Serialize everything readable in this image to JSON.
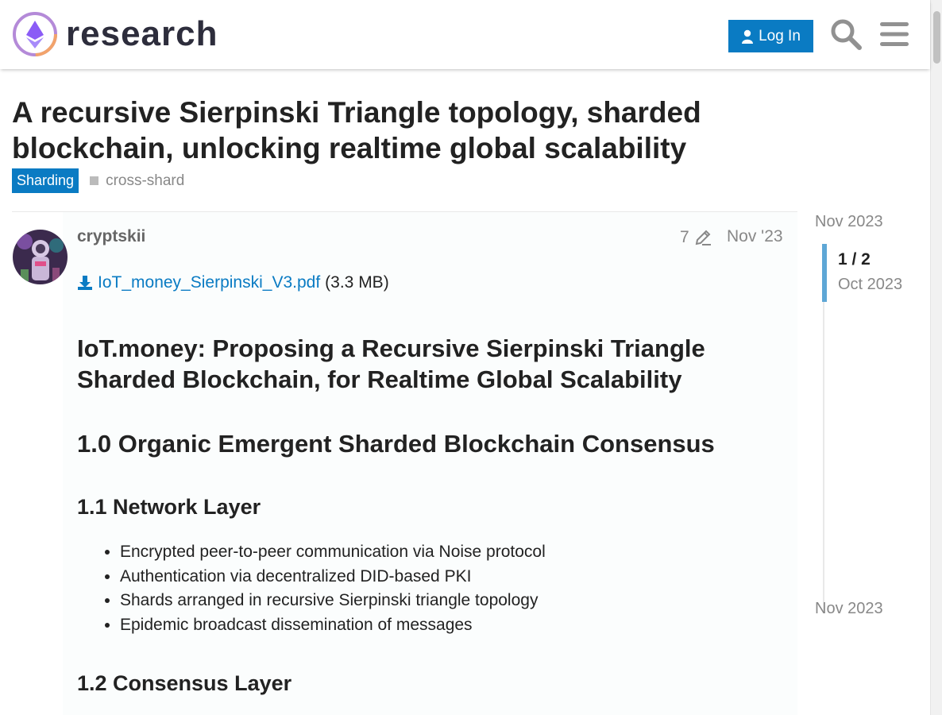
{
  "header": {
    "site_name": "research",
    "login_label": "Log In"
  },
  "topic": {
    "title": "A recursive Sierpinski Triangle topology, sharded blockchain, unlocking realtime global scalability",
    "category": "Sharding",
    "tags": [
      "cross-shard"
    ],
    "category_color": "#0a7bc3"
  },
  "post": {
    "username": "cryptskii",
    "edit_count": "7",
    "date": "Nov '23",
    "attachment_name": "IoT_money_Sierpinski_V3.pdf",
    "attachment_size": "(3.3 MB)",
    "heading_main": "IoT.money: Proposing a Recursive Sierpinski Triangle Sharded Blockchain, for Realtime Global Scalability",
    "heading_section": "1.0 Organic Emergent Sharded Blockchain Consensus",
    "heading_network": "1.1 Network Layer",
    "network_items": [
      "Encrypted peer-to-peer communication via Noise protocol",
      "Authentication via decentralized DID-based PKI",
      "Shards arranged in recursive Sierpinski triangle topology",
      "Epidemic broadcast dissemination of messages"
    ],
    "heading_consensus": "1.2 Consensus Layer"
  },
  "timeline": {
    "start_date": "Nov 2023",
    "counter": "1 / 2",
    "current_date": "Oct 2023",
    "end_date": "Nov 2023"
  },
  "colors": {
    "accent": "#0a7bc3",
    "muted": "#888888"
  },
  "icons": [
    "logo-icon",
    "user-icon",
    "search-icon",
    "hamburger-menu-icon",
    "pencil-icon",
    "download-icon",
    "avatar-image"
  ]
}
